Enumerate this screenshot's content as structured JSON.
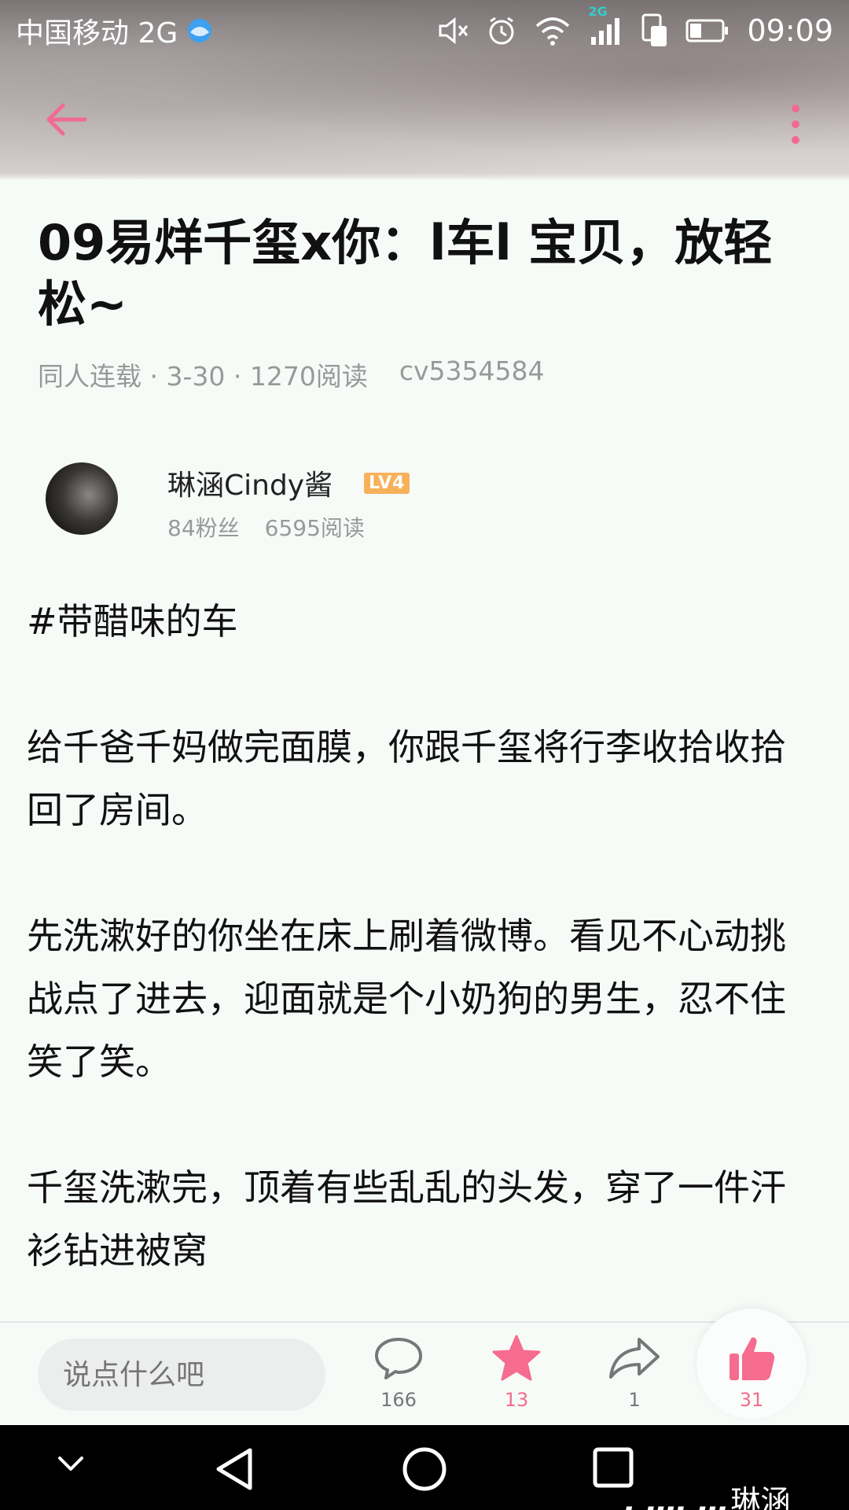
{
  "status_bar": {
    "carrier": "中国移动 2G",
    "network_badge": "2G",
    "time": "09:09",
    "icons": [
      "mute-icon",
      "alarm-icon",
      "wifi-icon",
      "signal-icon",
      "sim-icon",
      "battery-icon"
    ]
  },
  "header": {
    "back_icon": "back-arrow-icon",
    "more_icon": "more-vertical-icon",
    "accent_color": "#f06a95"
  },
  "article": {
    "title": "09易烊千玺x你：l车l 宝贝，放轻松~",
    "meta": {
      "category_date_reads": "同人连载 · 3-30 · 1270阅读",
      "id": "cv5354584"
    },
    "author": {
      "name": "琳涵Cindy酱",
      "level": "LV4",
      "fans": "84粉丝",
      "reads": "6595阅读"
    },
    "paragraphs": [
      "#带醋味的车",
      "给千爸千妈做完面膜，你跟千玺将行李收拾收拾回了房间。",
      "先洗漱好的你坐在床上刷着微博。看见不心动挑战点了进去，迎面就是个小奶狗的男生，忍不住笑了笑。",
      "千玺洗漱完，顶着有些乱乱的头发，穿了一件汗衫钻进被窝"
    ]
  },
  "bottom_bar": {
    "comment_placeholder": "说点什么吧",
    "comment_count": "166",
    "favorite_count": "13",
    "share_count": "1",
    "like_count": "31"
  },
  "watermark": {
    "logo": "bilibili",
    "user": "琳涵Cindy酱"
  }
}
